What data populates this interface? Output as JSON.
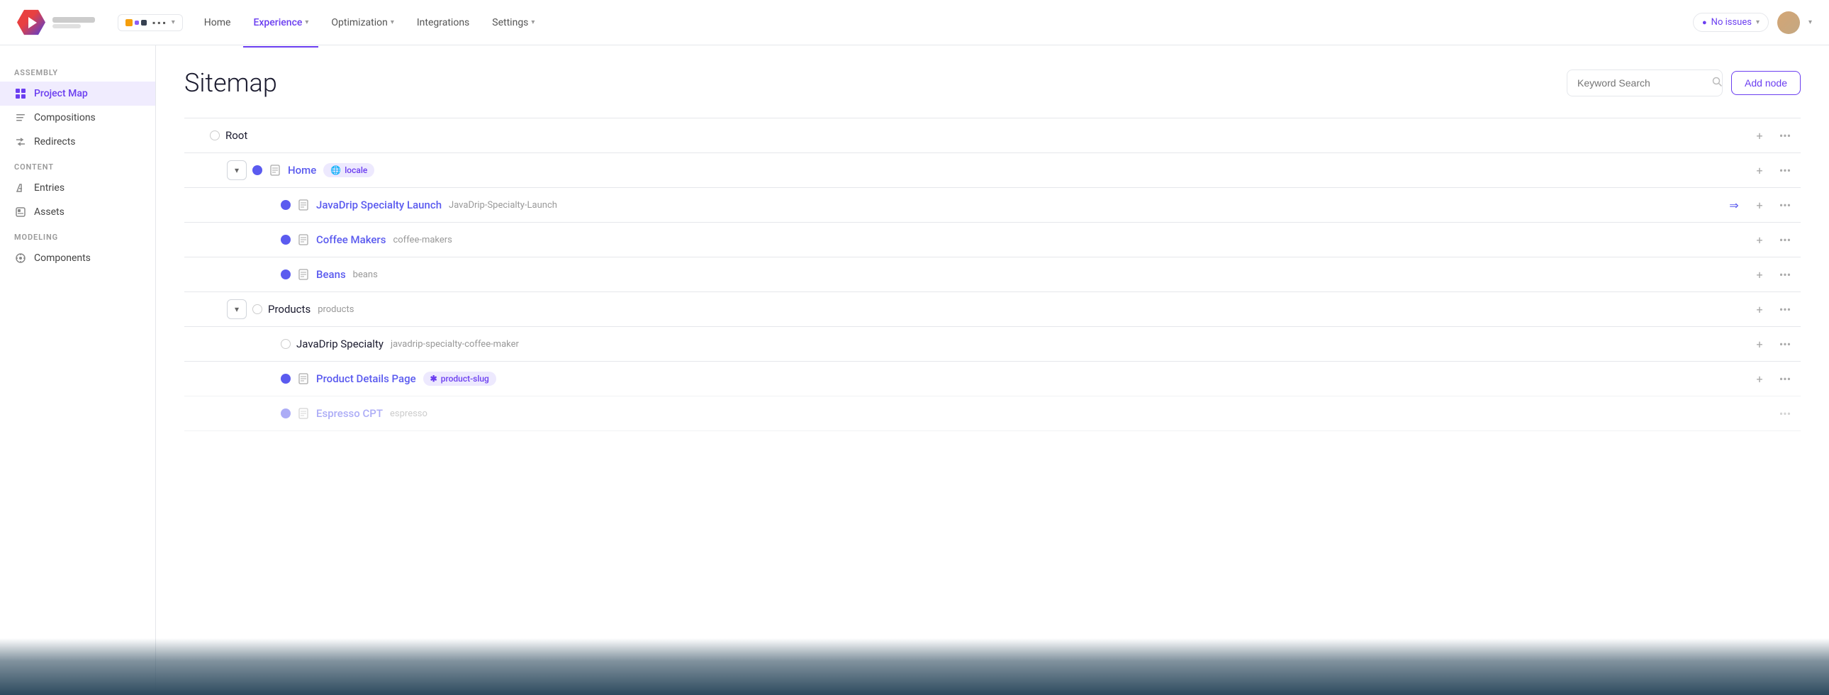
{
  "topnav": {
    "nav_items": [
      {
        "label": "Home",
        "active": false,
        "has_arrow": false
      },
      {
        "label": "Experience",
        "active": true,
        "has_arrow": true
      },
      {
        "label": "Optimization",
        "active": false,
        "has_arrow": true
      },
      {
        "label": "Integrations",
        "active": false,
        "has_arrow": false
      },
      {
        "label": "Settings",
        "active": false,
        "has_arrow": true
      }
    ],
    "no_issues_label": "No issues",
    "chevron": "▾"
  },
  "sidebar": {
    "assembly_label": "ASSEMBLY",
    "content_label": "CONTENT",
    "modeling_label": "MODELING",
    "items_assembly": [
      {
        "id": "project-map",
        "label": "Project Map",
        "icon": "⊞",
        "active": true
      },
      {
        "id": "compositions",
        "label": "Compositions",
        "icon": "☰",
        "active": false
      },
      {
        "id": "redirects",
        "label": "Redirects",
        "icon": "⇌",
        "active": false
      }
    ],
    "items_content": [
      {
        "id": "entries",
        "label": "Entries",
        "icon": "✏",
        "active": false
      },
      {
        "id": "assets",
        "label": "Assets",
        "icon": "▦",
        "active": false
      }
    ],
    "items_modeling": [
      {
        "id": "components",
        "label": "Components",
        "icon": "⚙",
        "active": false
      }
    ]
  },
  "page": {
    "title": "Sitemap",
    "search_placeholder": "Keyword Search",
    "add_node_label": "Add node"
  },
  "sitemap": {
    "rows": [
      {
        "id": "root",
        "indent": 0,
        "expandable": false,
        "has_expand_btn": false,
        "dot": "empty",
        "has_page_icon": false,
        "name": "Root",
        "name_plain": true,
        "slug": "",
        "badge": null,
        "has_move": false
      },
      {
        "id": "home",
        "indent": 1,
        "expandable": true,
        "has_expand_btn": true,
        "dot": "blue",
        "has_page_icon": true,
        "name": "Home",
        "name_plain": false,
        "slug": "",
        "badge": {
          "type": "locale",
          "icon": "🌐",
          "text": "locale"
        },
        "has_move": false
      },
      {
        "id": "javadrip-launch",
        "indent": 2,
        "expandable": false,
        "has_expand_btn": false,
        "dot": "blue",
        "has_page_icon": true,
        "name": "JavaDrip Specialty Launch",
        "name_plain": false,
        "slug": "JavaDrip-Specialty-Launch",
        "badge": null,
        "has_move": true
      },
      {
        "id": "coffee-makers",
        "indent": 2,
        "expandable": false,
        "has_expand_btn": false,
        "dot": "blue",
        "has_page_icon": true,
        "name": "Coffee Makers",
        "name_plain": false,
        "slug": "coffee-makers",
        "badge": null,
        "has_move": false
      },
      {
        "id": "beans",
        "indent": 2,
        "expandable": false,
        "has_expand_btn": false,
        "dot": "blue",
        "has_page_icon": true,
        "name": "Beans",
        "name_plain": false,
        "slug": "beans",
        "badge": null,
        "has_move": false
      },
      {
        "id": "products",
        "indent": 1,
        "expandable": true,
        "has_expand_btn": true,
        "dot": "empty",
        "has_page_icon": false,
        "name": "Products",
        "name_plain": true,
        "slug": "products",
        "badge": null,
        "has_move": false
      },
      {
        "id": "javadrip-specialty",
        "indent": 2,
        "expandable": false,
        "has_expand_btn": false,
        "dot": "empty",
        "has_page_icon": false,
        "name": "JavaDrip Specialty",
        "name_plain": true,
        "slug": "javadrip-specialty-coffee-maker",
        "badge": null,
        "has_move": false
      },
      {
        "id": "product-details",
        "indent": 2,
        "expandable": false,
        "has_expand_btn": false,
        "dot": "blue",
        "has_page_icon": true,
        "name": "Product Details Page",
        "name_plain": false,
        "slug": "",
        "badge": {
          "type": "slug",
          "icon": "*",
          "text": "product-slug"
        },
        "has_move": false
      },
      {
        "id": "espresso-cpt",
        "indent": 2,
        "expandable": false,
        "has_expand_btn": false,
        "dot": "blue",
        "has_page_icon": true,
        "name": "Espresso CPT",
        "name_plain": false,
        "slug": "espresso",
        "badge": null,
        "has_move": false
      }
    ]
  }
}
